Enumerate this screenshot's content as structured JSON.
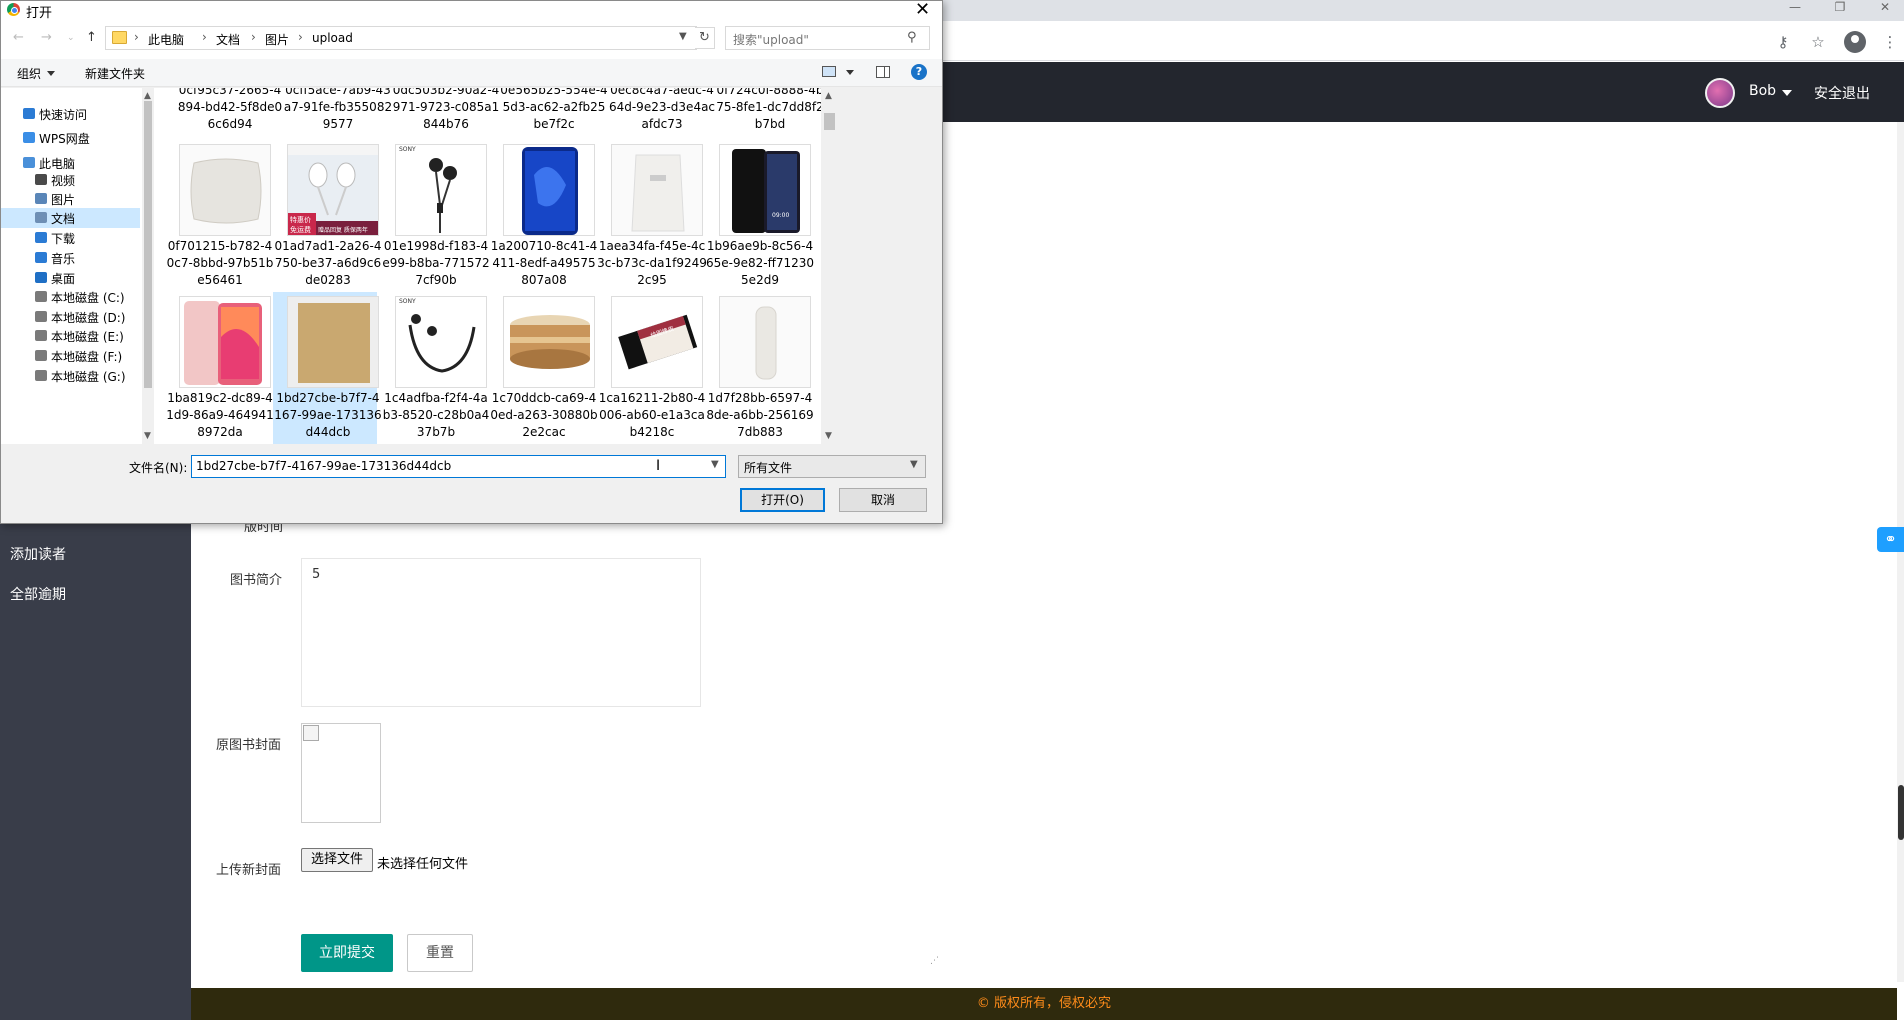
{
  "dialog": {
    "title": "打开",
    "close_glyph": "✕",
    "breadcrumb": [
      "此电脑",
      "文档",
      "图片",
      "upload"
    ],
    "search_placeholder": "搜索\"upload\"",
    "toolbar": {
      "organize": "组织",
      "new_folder": "新建文件夹"
    },
    "nav_tree": [
      {
        "label": "快速访问",
        "icon": "star-icon",
        "color": "#2b7bd4"
      },
      {
        "label": "WPS网盘",
        "icon": "cloud-icon",
        "color": "#3a8ee6"
      },
      {
        "label": "此电脑",
        "icon": "computer-icon",
        "color": "#4a90d9"
      },
      {
        "label": "视频",
        "icon": "video-icon",
        "color": "#4a4a4a"
      },
      {
        "label": "图片",
        "icon": "picture-icon",
        "color": "#5a86b8"
      },
      {
        "label": "文档",
        "icon": "document-icon",
        "color": "#6e8fb5",
        "selected": true
      },
      {
        "label": "下载",
        "icon": "download-icon",
        "color": "#2b7bd4"
      },
      {
        "label": "音乐",
        "icon": "music-icon",
        "color": "#2b7bd4"
      },
      {
        "label": "桌面",
        "icon": "desktop-icon",
        "color": "#1f6fc5"
      },
      {
        "label": "本地磁盘 (C:)",
        "icon": "drive-icon",
        "color": "#7a7a7a"
      },
      {
        "label": "本地磁盘 (D:)",
        "icon": "drive-icon",
        "color": "#7a7a7a"
      },
      {
        "label": "本地磁盘 (E:)",
        "icon": "drive-icon",
        "color": "#7a7a7a"
      },
      {
        "label": "本地磁盘 (F:)",
        "icon": "drive-icon",
        "color": "#7a7a7a"
      },
      {
        "label": "本地磁盘 (G:)",
        "icon": "drive-icon",
        "color": "#7a7a7a"
      }
    ],
    "top_row_files": [
      "0cf95c37-2665-4894-bd42-5f8de06c6d94",
      "0cff5ace-7ab9-43a7-91fe-fb3550829577",
      "0dc503b2-90a2-4971-9723-c085a1844b76",
      "0e565b25-554e-45d3-ac62-a2fb25be7f2c",
      "0ec8c4a7-aedc-464d-9e23-d3e4acafdc73",
      "0f724c0f-8888-4b75-8fe1-dc7dd8f2b7bd"
    ],
    "files": [
      {
        "name": "0f701215-b782-40c7-8bbd-97b51be56461",
        "thumb": "pillow"
      },
      {
        "name": "01ad7ad1-2a26-4750-be37-a6d9c6de0283",
        "thumb": "earbuds",
        "badge1": "特惠价",
        "badge2": "免运费",
        "badge3": "赠品回复 质保两年"
      },
      {
        "name": "01e1998d-f183-4e99-b8ba-7715727cf90b",
        "thumb": "earphones",
        "brand": "SONY"
      },
      {
        "name": "1a200710-8c41-4411-8edf-a49575807a08",
        "thumb": "phone-blue"
      },
      {
        "name": "1aea34fa-f45e-4c3c-b73c-da1f92492c95",
        "thumb": "pouch"
      },
      {
        "name": "1b96ae9b-8c56-465e-9e82-ff712305e2d9",
        "thumb": "phone-black",
        "time": "09:00"
      },
      {
        "name": "1ba819c2-dc89-41d9-86a9-4649418972da",
        "thumb": "phone-pink"
      },
      {
        "name": "1bd27cbe-b7f7-4167-99ae-173136d44dcb",
        "thumb": "envelope",
        "selected": true
      },
      {
        "name": "1c4adfba-f2f4-4ab3-8520-c28b0a437b7b",
        "thumb": "neckband",
        "brand": "SONY"
      },
      {
        "name": "1c70ddcb-ca69-40ed-a263-30880b2e2cac",
        "thumb": "jar"
      },
      {
        "name": "1ca16211-2b80-4006-ab60-e1a3cab4218c",
        "thumb": "eraser",
        "label": "绘图橡皮"
      },
      {
        "name": "1d7f28bb-6597-48de-a6bb-2561697db883",
        "thumb": "cylinder"
      }
    ],
    "filename_label": "文件名(N):",
    "filename_value": "1bd27cbe-b7f7-4167-99ae-173136d44dcb",
    "filetype_value": "所有文件",
    "open_button": "打开(O)",
    "cancel_button": "取消"
  },
  "header": {
    "username": "Bob",
    "logout": "安全退出"
  },
  "sidebar": {
    "items": [
      "添加读者",
      "全部逾期"
    ]
  },
  "form": {
    "partial_label": "版时间",
    "intro_label": "图书简介",
    "intro_value": "5",
    "cover_label": "原图书封面",
    "upload_label": "上传新封面",
    "choose_file": "选择文件",
    "no_file": "未选择任何文件",
    "submit": "立即提交",
    "reset": "重置"
  },
  "footer": {
    "text": "© 版权所有，侵权必究"
  },
  "colors": {
    "accent": "#009688",
    "header_bg": "#23262e",
    "sidebar_bg": "#393d49",
    "footer_text": "#ff8c1a",
    "selection": "#cce8ff"
  }
}
